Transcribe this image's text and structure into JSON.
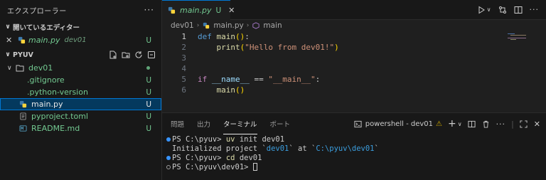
{
  "sidebar": {
    "title": "エクスプローラー",
    "more": "···",
    "open_editors": {
      "header": "開いているエディター",
      "items": [
        {
          "name": "main.py",
          "folder": "dev01",
          "badge": "U"
        }
      ]
    },
    "project": {
      "header": "PYUV",
      "folder": "dev01",
      "files": [
        {
          "name": ".gitignore",
          "badge": "U"
        },
        {
          "name": ".python-version",
          "badge": "U"
        },
        {
          "name": "main.py",
          "badge": "U"
        },
        {
          "name": "pyproject.toml",
          "badge": "U"
        },
        {
          "name": "README.md",
          "badge": "U"
        }
      ]
    }
  },
  "editor": {
    "tab": {
      "name": "main.py",
      "badge": "U"
    },
    "breadcrumb": [
      "dev01",
      "main.py",
      "main"
    ],
    "lines": [
      "1",
      "2",
      "3",
      "4",
      "5",
      "6"
    ]
  },
  "panel": {
    "tabs": [
      "問題",
      "出力",
      "ターミナル",
      "ポート"
    ],
    "terminal_name": "powershell - dev01",
    "terminal": {
      "l1_prompt": "PS C:\\pyuv> ",
      "l1_cmd": "uv",
      "l1_args": " init dev01",
      "l2_a": "Initialized project `",
      "l2_b": "dev01",
      "l2_c": "` at `",
      "l2_d": "C:\\pyuv\\dev01",
      "l2_e": "`",
      "l3_prompt": "PS C:\\pyuv> ",
      "l3_cmd": "cd",
      "l3_args": " dev01",
      "l4_prompt": "PS C:\\pyuv\\dev01> "
    }
  }
}
